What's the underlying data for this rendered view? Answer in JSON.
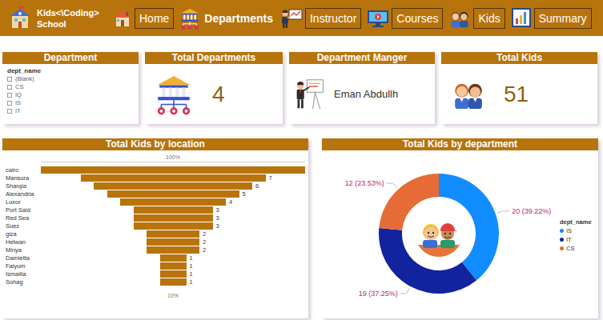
{
  "logo": {
    "title": "Kids<\\Coding>",
    "subtitle": "School"
  },
  "nav": [
    {
      "label": "Home",
      "selected": false
    },
    {
      "label": "Departments",
      "selected": true
    },
    {
      "label": "Instructor",
      "selected": false
    },
    {
      "label": "Courses",
      "selected": false
    },
    {
      "label": "Kids",
      "selected": false
    },
    {
      "label": "Summary",
      "selected": false
    }
  ],
  "slicer": {
    "title": "Department",
    "field": "dept_name",
    "options": [
      {
        "label": "(Blank)",
        "checked": false
      },
      {
        "label": "CS",
        "checked": false
      },
      {
        "label": "IQ",
        "checked": false
      },
      {
        "label": "IS",
        "checked": false
      },
      {
        "label": "IT",
        "checked": false
      }
    ]
  },
  "total_departments": {
    "title": "Total Departments",
    "value": "4"
  },
  "manager": {
    "title": "Department Manger",
    "name": "Eman Abdullh"
  },
  "total_kids": {
    "title": "Total Kids",
    "value": "51"
  },
  "funnel": {
    "title": "Total Kids by location",
    "top_label": "100%",
    "bottom_label": "10%",
    "items": [
      {
        "name": "cairo",
        "value": 10
      },
      {
        "name": "Mansura",
        "value": 7,
        "label": "7"
      },
      {
        "name": "Sharqia",
        "value": 6,
        "label": "6"
      },
      {
        "name": "Alexandria",
        "value": 5,
        "label": "5"
      },
      {
        "name": "Luxor",
        "value": 4,
        "label": "4"
      },
      {
        "name": "Port Said",
        "value": 3,
        "label": "3"
      },
      {
        "name": "Red Sea",
        "value": 3,
        "label": "3"
      },
      {
        "name": "Suez",
        "value": 3,
        "label": "3"
      },
      {
        "name": "giza",
        "value": 2,
        "label": "2"
      },
      {
        "name": "Helwan",
        "value": 2,
        "label": "2"
      },
      {
        "name": "Minya",
        "value": 2,
        "label": "2"
      },
      {
        "name": "Damietta",
        "value": 1,
        "label": "1"
      },
      {
        "name": "Faiyum",
        "value": 1,
        "label": "1"
      },
      {
        "name": "Ismailia",
        "value": 1,
        "label": "1"
      },
      {
        "name": "Sohag",
        "value": 1,
        "label": "1"
      }
    ]
  },
  "donut": {
    "title": "Total Kids by department",
    "legend_title": "dept_name",
    "slices": [
      {
        "name": "IS",
        "value": 20,
        "label": "20 (39.22%)",
        "color": "#118dff"
      },
      {
        "name": "IT",
        "value": 19,
        "label": "19 (37.25%)",
        "color": "#12239e"
      },
      {
        "name": "CS",
        "value": 12,
        "label": "12 (23.53%)",
        "color": "#e66c37"
      }
    ]
  }
}
